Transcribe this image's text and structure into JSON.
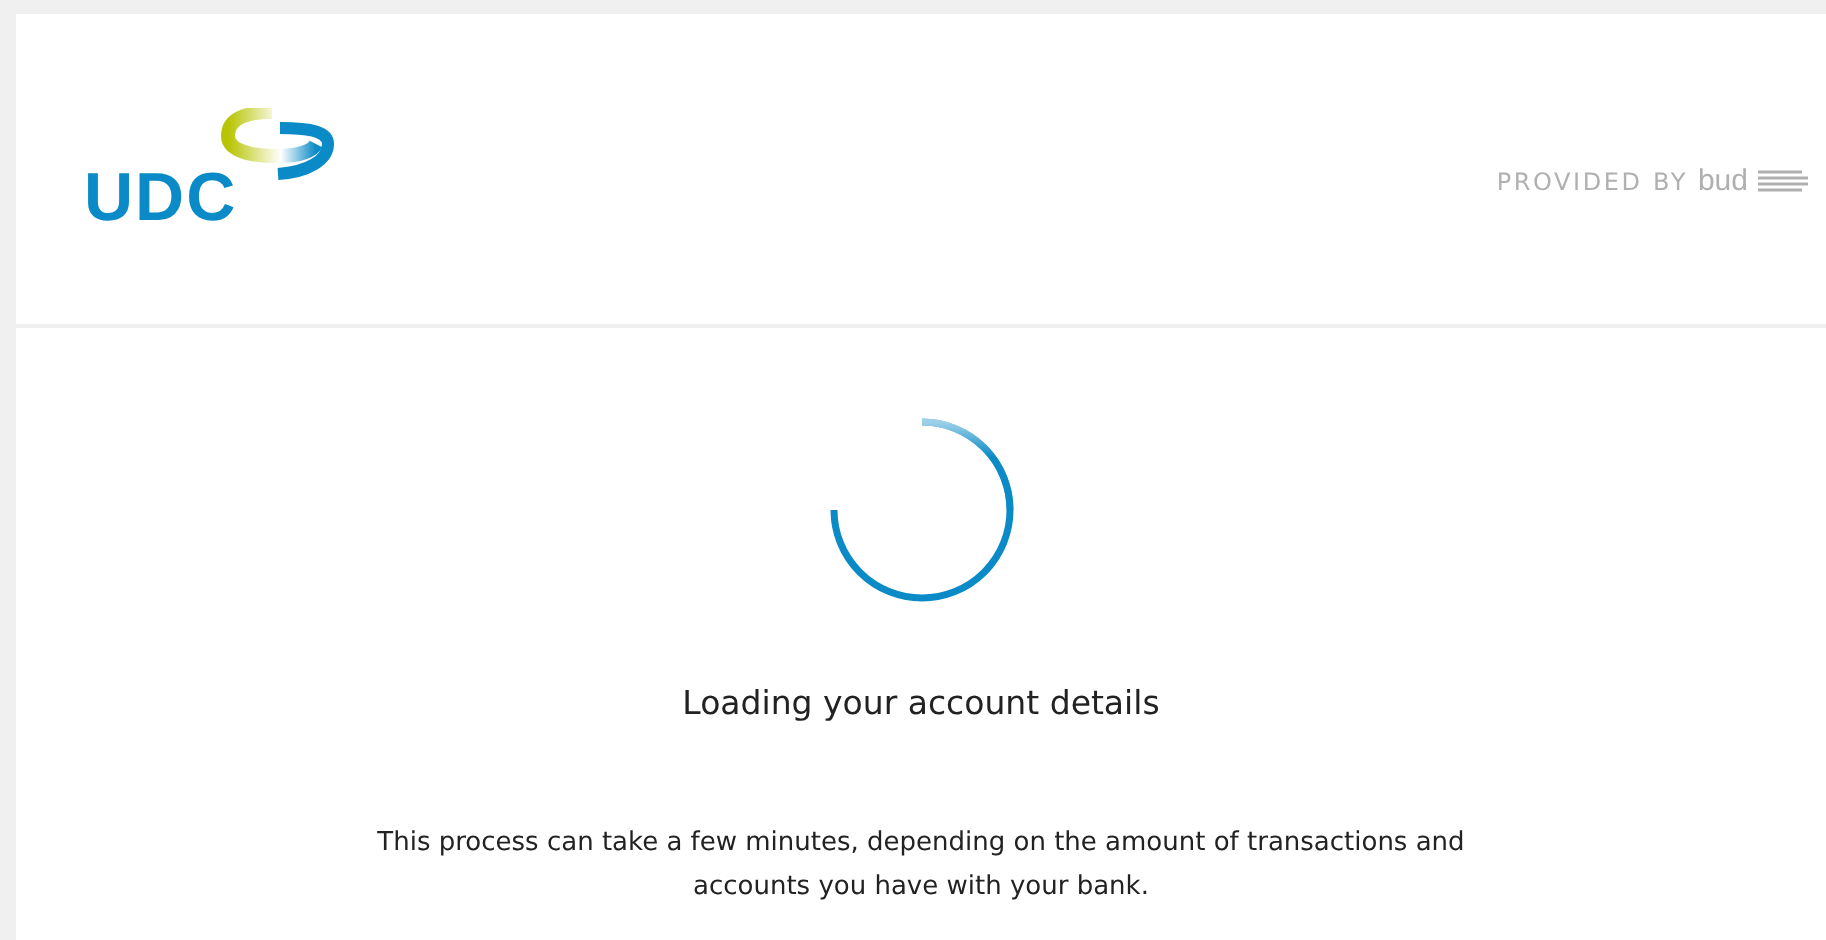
{
  "header": {
    "logo": "UDC",
    "provider_label": "PROVIDED BY",
    "provider_logo": "bud"
  },
  "loading": {
    "title": "Loading your account details",
    "message": "This process can take a few minutes, depending on the amount of transactions and accounts you have with your bank."
  }
}
